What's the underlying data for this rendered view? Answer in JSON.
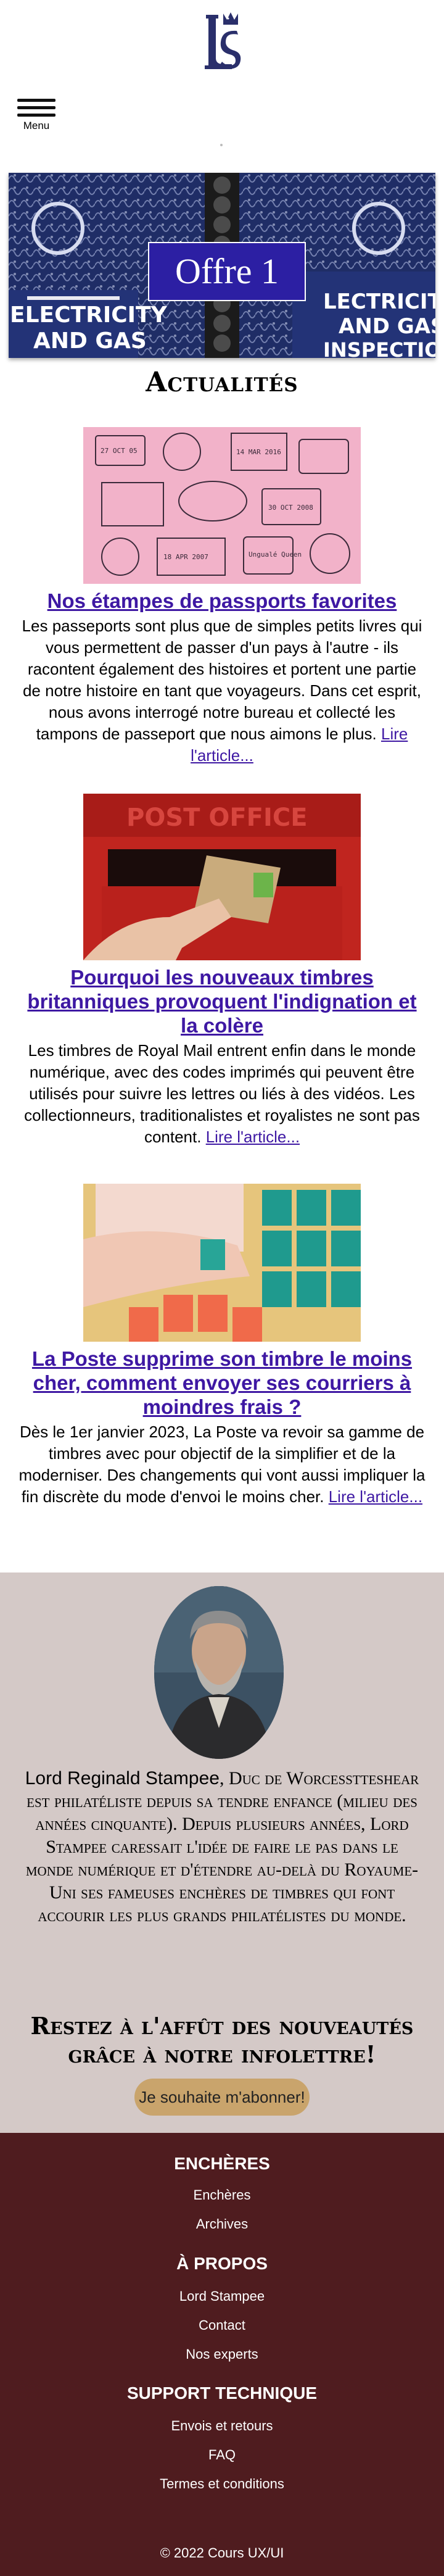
{
  "header": {
    "menu_label": "Menu",
    "logo_letters": "LS"
  },
  "banner": {
    "label": "Offre 1",
    "stamp_text_top": "ELECTRICITY",
    "stamp_text_bottom": "AND GAS",
    "stamp_text_right_top": "LECTRICITY",
    "stamp_text_right_mid": "AND GAS",
    "stamp_text_right_bot": "INSPECTION"
  },
  "news": {
    "title": "Actualités",
    "articles": [
      {
        "title": "Nos étampes de passports favorites",
        "text": "Les passeports sont plus que de simples petits livres qui vous permettent de passer d'un pays à l'autre - ils racontent également des histoires et portent une partie de notre histoire en tant que voyageurs. Dans cet esprit, nous avons interrogé notre bureau et collecté les tampons de passeport que nous aimons le plus.",
        "read_more": "Lire l'article..."
      },
      {
        "title": "Pourquoi les nouveaux timbres britanniques provoquent l'indignation et la colère",
        "text": "Les timbres de Royal Mail entrent enfin dans le monde numérique, avec des codes imprimés qui peuvent être utilisés pour suivre les lettres ou liés à des vidéos. Les collectionneurs, traditionalistes et royalistes ne sont pas content.",
        "read_more": "Lire l'article...",
        "image_text": "POST OFFICE"
      },
      {
        "title": "La Poste supprime son timbre le moins cher, comment envoyer ses courriers à moindres frais ?",
        "text": "Dès le 1er janvier 2023, La Poste va revoir sa gamme de timbres avec pour objectif de la simplifier et de la moderniser. Des changements qui vont aussi impliquer la fin discrète du mode d'envoi le moins cher.",
        "read_more": "Lire l'article..."
      }
    ]
  },
  "bio": {
    "name": "Lord Reginald Stampee",
    "text": ", Duc de Worcesstteshear est philatéliste depuis sa tendre enfance (milieu des années cinquante). Depuis plusieurs années, Lord Stampee caressait l'idée de faire le pas dans le monde numérique et d'étendre au-delà du Royaume-Uni ses fameuses enchères de timbres qui font accourir les plus grands philatélistes du monde."
  },
  "newsletter": {
    "title": "Restez à l'affût des nouveautés grâce à notre infolettre!",
    "button": "Je souhaite m'abonner!"
  },
  "footer": {
    "sections": [
      {
        "heading": "ENCHÈRES",
        "links": [
          "Enchères",
          "Archives"
        ]
      },
      {
        "heading": "À PROPOS",
        "links": [
          "Lord Stampee",
          "Contact",
          "Nos experts"
        ]
      },
      {
        "heading": "SUPPORT TECHNIQUE",
        "links": [
          "Envois et retours",
          "FAQ",
          "Termes et conditions"
        ]
      }
    ],
    "copyright": "© 2022 Cours UX/UI"
  },
  "colors": {
    "link": "#3e18a3",
    "offer_bg": "#2c1fa3",
    "bio_bg": "#d4c9c7",
    "button_bg": "#c9a46c",
    "footer_bg": "#4f1c1f"
  }
}
